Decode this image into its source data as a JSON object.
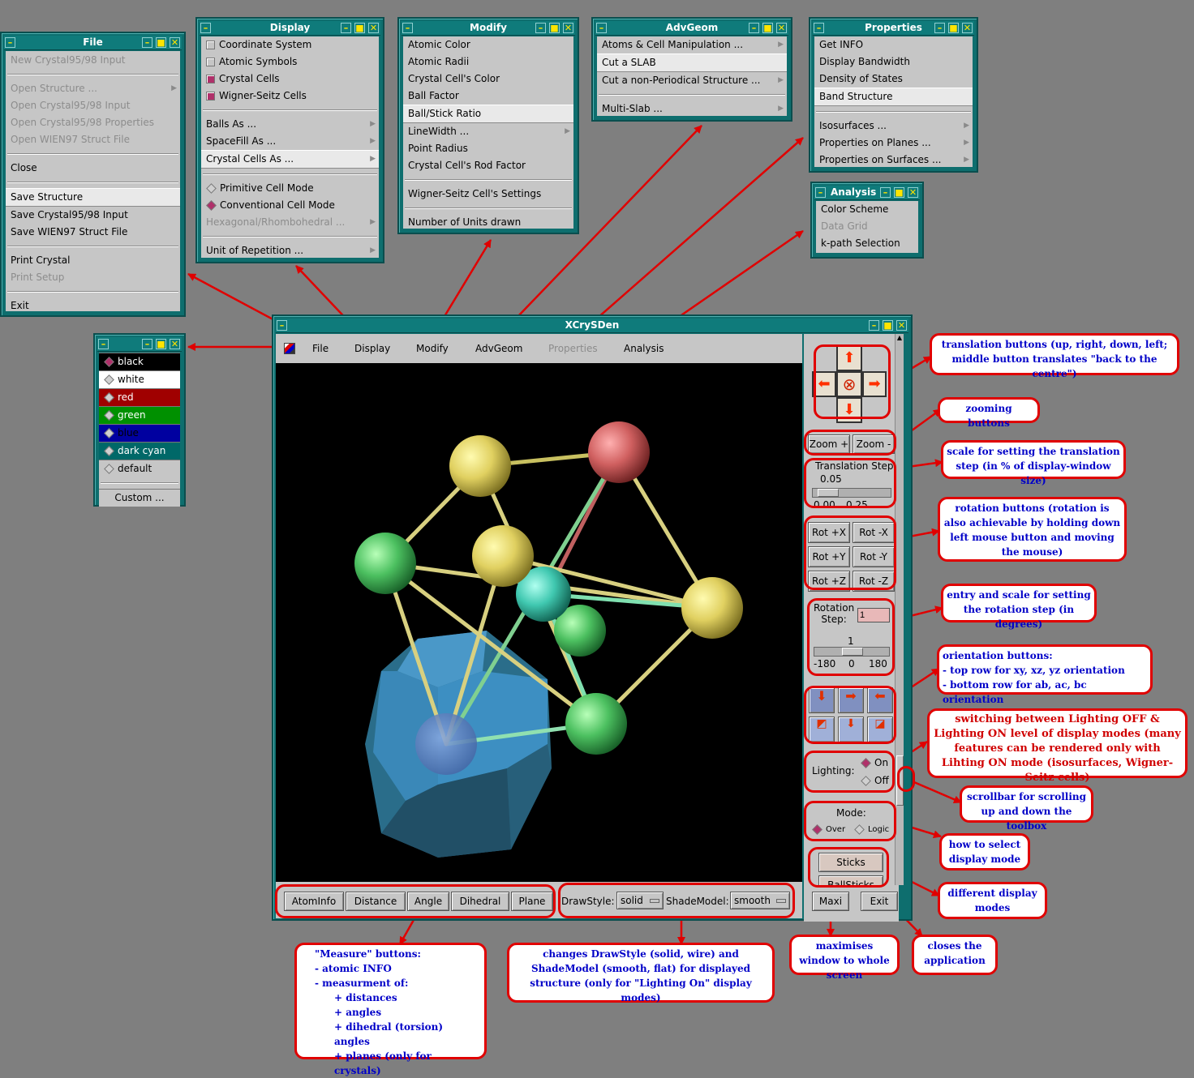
{
  "file_menu": {
    "title": "File",
    "items": [
      {
        "label": "New Crystal95/98 Input",
        "disabled": true
      },
      {
        "sep": true
      },
      {
        "label": "Open Structure ...",
        "disabled": true,
        "sub": true
      },
      {
        "label": "Open Crystal95/98 Input",
        "disabled": true
      },
      {
        "label": "Open Crystal95/98 Properties",
        "disabled": true
      },
      {
        "label": "Open WIEN97 Struct File",
        "disabled": true
      },
      {
        "sep": true
      },
      {
        "label": "Close"
      },
      {
        "sep": true
      },
      {
        "label": "Save Structure",
        "highlight": true
      },
      {
        "label": "Save Crystal95/98 Input"
      },
      {
        "label": "Save WIEN97 Struct File"
      },
      {
        "sep": true
      },
      {
        "label": "Print Crystal"
      },
      {
        "label": "Print Setup",
        "disabled": true
      },
      {
        "sep": true
      },
      {
        "label": "Exit"
      }
    ]
  },
  "display_menu": {
    "title": "Display",
    "items": [
      {
        "label": "Coordinate System",
        "check": "off"
      },
      {
        "label": "Atomic Symbols",
        "check": "off"
      },
      {
        "label": "Crystal Cells",
        "check": "on"
      },
      {
        "label": "Wigner-Seitz Cells",
        "check": "on"
      },
      {
        "sep": true
      },
      {
        "label": "Balls As ...",
        "sub": true
      },
      {
        "label": "SpaceFill As ...",
        "sub": true
      },
      {
        "label": "Crystal Cells As ...",
        "sub": true,
        "highlight": true
      },
      {
        "sep": true
      },
      {
        "label": "Primitive Cell Mode",
        "radio": "off"
      },
      {
        "label": "Conventional Cell Mode",
        "radio": "on"
      },
      {
        "label": "Hexagonal/Rhombohedral ...",
        "disabled": true,
        "sub": true
      },
      {
        "sep": true
      },
      {
        "label": "Unit of Repetition ...",
        "sub": true
      }
    ]
  },
  "modify_menu": {
    "title": "Modify",
    "items": [
      {
        "label": "Atomic Color"
      },
      {
        "label": "Atomic Radii"
      },
      {
        "label": "Crystal Cell's Color"
      },
      {
        "label": "Ball Factor"
      },
      {
        "label": "Ball/Stick Ratio",
        "highlight": true
      },
      {
        "label": "LineWidth ...",
        "sub": true
      },
      {
        "label": "Point Radius"
      },
      {
        "label": "Crystal Cell's Rod Factor"
      },
      {
        "sep": true
      },
      {
        "label": "Wigner-Seitz Cell's Settings"
      },
      {
        "sep": true
      },
      {
        "label": "Number of Units drawn"
      }
    ]
  },
  "advgeom_menu": {
    "title": "AdvGeom",
    "items": [
      {
        "label": "Atoms & Cell Manipulation ...",
        "sub": true
      },
      {
        "label": "Cut a SLAB",
        "highlight": true
      },
      {
        "label": "Cut a non-Periodical Structure ...",
        "sub": true
      },
      {
        "sep": true
      },
      {
        "label": "Multi-Slab ...",
        "sub": true
      }
    ]
  },
  "properties_menu": {
    "title": "Properties",
    "items": [
      {
        "label": "Get INFO"
      },
      {
        "label": "Display Bandwidth"
      },
      {
        "label": "Density of States"
      },
      {
        "label": "Band Structure",
        "highlight": true
      },
      {
        "sep": true
      },
      {
        "label": "Isosurfaces ...",
        "sub": true
      },
      {
        "label": "Properties on Planes ...",
        "sub": true
      },
      {
        "label": "Properties on Surfaces ...",
        "sub": true
      }
    ]
  },
  "analysis_menu": {
    "title": "Analysis",
    "items": [
      {
        "label": "Color Scheme"
      },
      {
        "label": "Data Grid",
        "disabled": true
      },
      {
        "label": "k-path Selection"
      }
    ]
  },
  "color_menu": {
    "items": [
      {
        "label": "black",
        "bg": "#000000",
        "fg": "#ffffff",
        "on": true
      },
      {
        "label": "white",
        "bg": "#ffffff",
        "fg": "#000000"
      },
      {
        "label": "red",
        "bg": "#a00000",
        "fg": "#ffffff"
      },
      {
        "label": "green",
        "bg": "#009000",
        "fg": "#ffffff"
      },
      {
        "label": "blue",
        "bg": "#0000a0",
        "fg": "#000000"
      },
      {
        "label": "dark cyan",
        "bg": "#006868",
        "fg": "#ffffff"
      },
      {
        "label": "default",
        "bg": "#c6c6c6",
        "fg": "#000000"
      },
      {
        "sep": true
      },
      {
        "label": "Custom ...",
        "bg": "#c6c6c6",
        "fg": "#000000",
        "center": true
      }
    ]
  },
  "main": {
    "title": "XCrySDen",
    "menubar": [
      "File",
      "Display",
      "Modify",
      "AdvGeom",
      "Properties",
      "Analysis"
    ],
    "zoom_plus": "Zoom +",
    "zoom_minus": "Zoom -",
    "translation_label": "Translation Step",
    "translation_value": "0.05",
    "translation_min": "0.00",
    "translation_max": "0.25",
    "rot": [
      "Rot +X",
      "Rot -X",
      "Rot +Y",
      "Rot -Y",
      "Rot +Z",
      "Rot -Z"
    ],
    "rotation_label": "Rotation\nStep:",
    "rotation_entry": "1",
    "rotation_value": "1",
    "rotation_ticks": [
      "-180",
      "0",
      "180"
    ],
    "lighting_label": "Lighting:",
    "lighting_on": "On",
    "lighting_off": "Off",
    "mode_label": "Mode:",
    "mode_over": "Over",
    "mode_logic": "Logic",
    "sticks": "Sticks",
    "ballsticks": "BallSticks",
    "measure": [
      "AtomInfo",
      "Distance",
      "Angle",
      "Dihedral",
      "Plane"
    ],
    "drawstyle_label": "DrawStyle:",
    "drawstyle_value": "solid",
    "shademodel_label": "ShadeModel:",
    "shademodel_value": "smooth",
    "maxi": "Maxi",
    "exit": "Exit"
  },
  "annotations": {
    "translation": "translation buttons (up, right, down, left; middle button translates \"back to the centre\")",
    "zooming": "zooming buttons",
    "scale": "scale for setting the translation step (in % of display-window size)",
    "rotation": "rotation buttons (rotation is also achievable by holding down left mouse button and moving the mouse)",
    "rotentry": "entry and scale for setting the rotation step (in degrees)",
    "orient_title": "orientation buttons:",
    "orient_1": "- top row for xy, xz, yz orientation",
    "orient_2": "- bottom row for ab, ac, bc orientation",
    "lighting": "switching between Lighting OFF & Lighting ON level of display modes (many features can be rendered only with Lihting ON mode (isosurfaces, Wigner-Seitz cells)",
    "scrollbar": "scrollbar for scrolling up and down the toolbox",
    "mode": "how to select display mode",
    "displaymodes": "different display modes",
    "measure_lines": [
      "\"Measure\" buttons:",
      "- atomic INFO",
      "- measurment of:",
      "+ distances",
      "+ angles",
      "+ dihedral (torsion) angles",
      "+ planes (only for crystals)"
    ],
    "drawstyle": "changes DrawStyle (solid, wire) and ShadeModel (smooth, flat) for displayed structure (only for \"Lighting On\" display modes)",
    "maxi": "maximises window to whole screen",
    "closes": "closes the application"
  },
  "colors": {
    "frame": "#0e6e6e",
    "panel": "#c6c6c6",
    "accent_red": "#e00000",
    "note_text": "#0000c8"
  }
}
